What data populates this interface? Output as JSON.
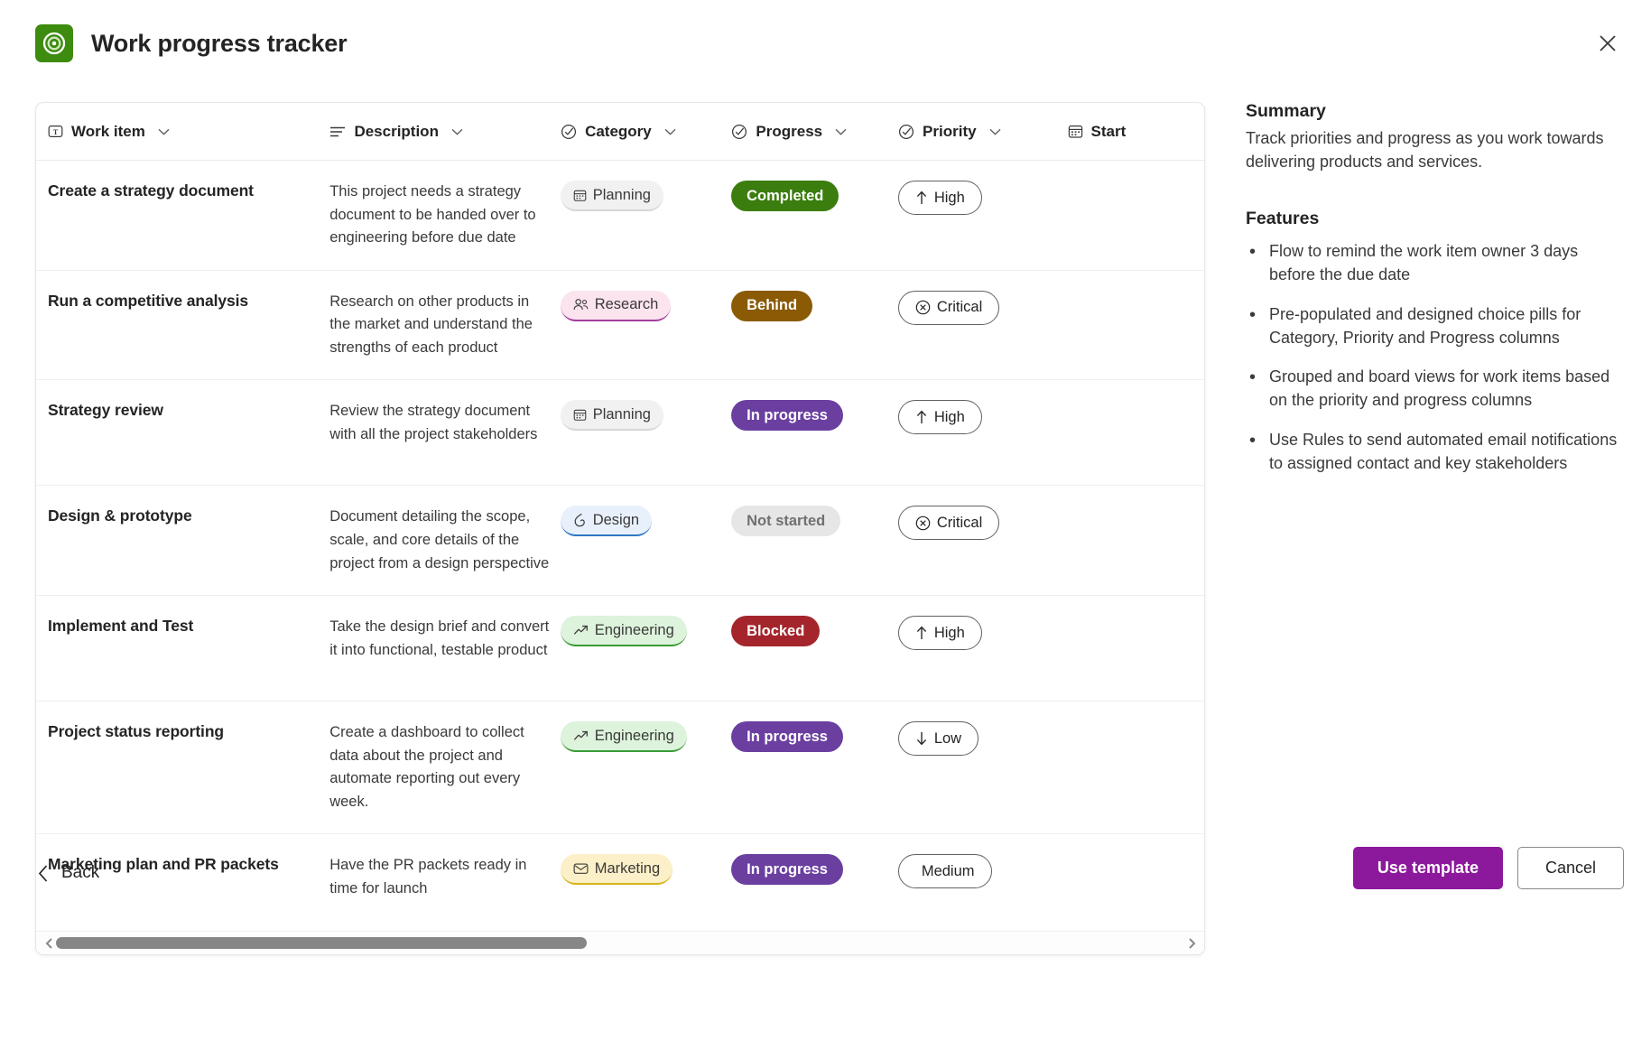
{
  "header": {
    "title": "Work progress tracker",
    "app_icon": "target-circle-icon",
    "close_label": "close-icon"
  },
  "table": {
    "columns": [
      {
        "label": "Work item",
        "icon": "text-field-icon",
        "has_chevron": true
      },
      {
        "label": "Description",
        "icon": "multiline-text-icon",
        "has_chevron": true
      },
      {
        "label": "Category",
        "icon": "choice-check-icon",
        "has_chevron": true
      },
      {
        "label": "Progress",
        "icon": "choice-check-icon",
        "has_chevron": true
      },
      {
        "label": "Priority",
        "icon": "choice-check-icon",
        "has_chevron": true
      },
      {
        "label": "Start",
        "icon": "calendar-icon",
        "has_chevron": false
      }
    ],
    "rows": [
      {
        "work_item": "Create a strategy document",
        "description": "This project needs a strategy document to be handed over to engineering before due date",
        "category": "Planning",
        "category_icon": "calendar-icon",
        "category_class": "pill-planning",
        "progress": "Completed",
        "progress_class": "st-completed",
        "priority": "High",
        "priority_icon": "arrow-up-icon"
      },
      {
        "work_item": "Run a competitive analysis",
        "description": "Research on other products in the market and understand the strengths of each product",
        "category": "Research",
        "category_icon": "people-icon",
        "category_class": "pill-research",
        "progress": "Behind",
        "progress_class": "st-behind",
        "priority": "Critical",
        "priority_icon": "x-circle-icon"
      },
      {
        "work_item": "Strategy review",
        "description": "Review the strategy document with all the project stakeholders",
        "category": "Planning",
        "category_icon": "calendar-icon",
        "category_class": "pill-planning",
        "progress": "In progress",
        "progress_class": "st-inprogress",
        "priority": "High",
        "priority_icon": "arrow-up-icon"
      },
      {
        "work_item": "Design & prototype",
        "description": "Document detailing the scope, scale, and core details of the project from a design perspective",
        "category": "Design",
        "category_icon": "drop-icon",
        "category_class": "pill-design",
        "progress": "Not started",
        "progress_class": "st-notstarted",
        "priority": "Critical",
        "priority_icon": "x-circle-icon"
      },
      {
        "work_item": "Implement and Test",
        "description": "Take the design brief and convert it into functional, testable product",
        "category": "Engineering",
        "category_icon": "trending-up-icon",
        "category_class": "pill-engineering",
        "progress": "Blocked",
        "progress_class": "st-blocked",
        "priority": "High",
        "priority_icon": "arrow-up-icon"
      },
      {
        "work_item": "Project status reporting",
        "description": "Create a dashboard to collect data about the project and automate reporting out every week.",
        "category": "Engineering",
        "category_icon": "trending-up-icon",
        "category_class": "pill-engineering",
        "progress": "In progress",
        "progress_class": "st-inprogress",
        "priority": "Low",
        "priority_icon": "arrow-down-icon"
      },
      {
        "work_item": "Marketing plan and PR packets",
        "description": "Have the PR packets ready in time for launch",
        "category": "Marketing",
        "category_icon": "envelope-icon",
        "category_class": "pill-marketing",
        "progress": "In progress",
        "progress_class": "st-inprogress",
        "priority": "Medium",
        "priority_icon": "none"
      }
    ]
  },
  "side_panel": {
    "summary_heading": "Summary",
    "summary_text": "Track priorities and progress as you work towards delivering products and services.",
    "features_heading": "Features",
    "features": [
      "Flow to remind the work item owner 3 days before the due date",
      "Pre-populated and designed choice pills for Category, Priority and Progress columns",
      "Grouped and board views for work items based on the priority and progress columns",
      "Use Rules to send automated email notifications to assigned contact and key stakeholders"
    ]
  },
  "footer": {
    "back_label": "Back",
    "use_template_label": "Use template",
    "cancel_label": "Cancel"
  },
  "colors": {
    "accent": "#8c199c",
    "app_icon_bg": "#3d8b0f",
    "completed": "#3b7d0e",
    "behind": "#8a5a05",
    "in_progress": "#6b3fa0",
    "blocked": "#a4262c",
    "not_started": "#e6e6e6"
  }
}
